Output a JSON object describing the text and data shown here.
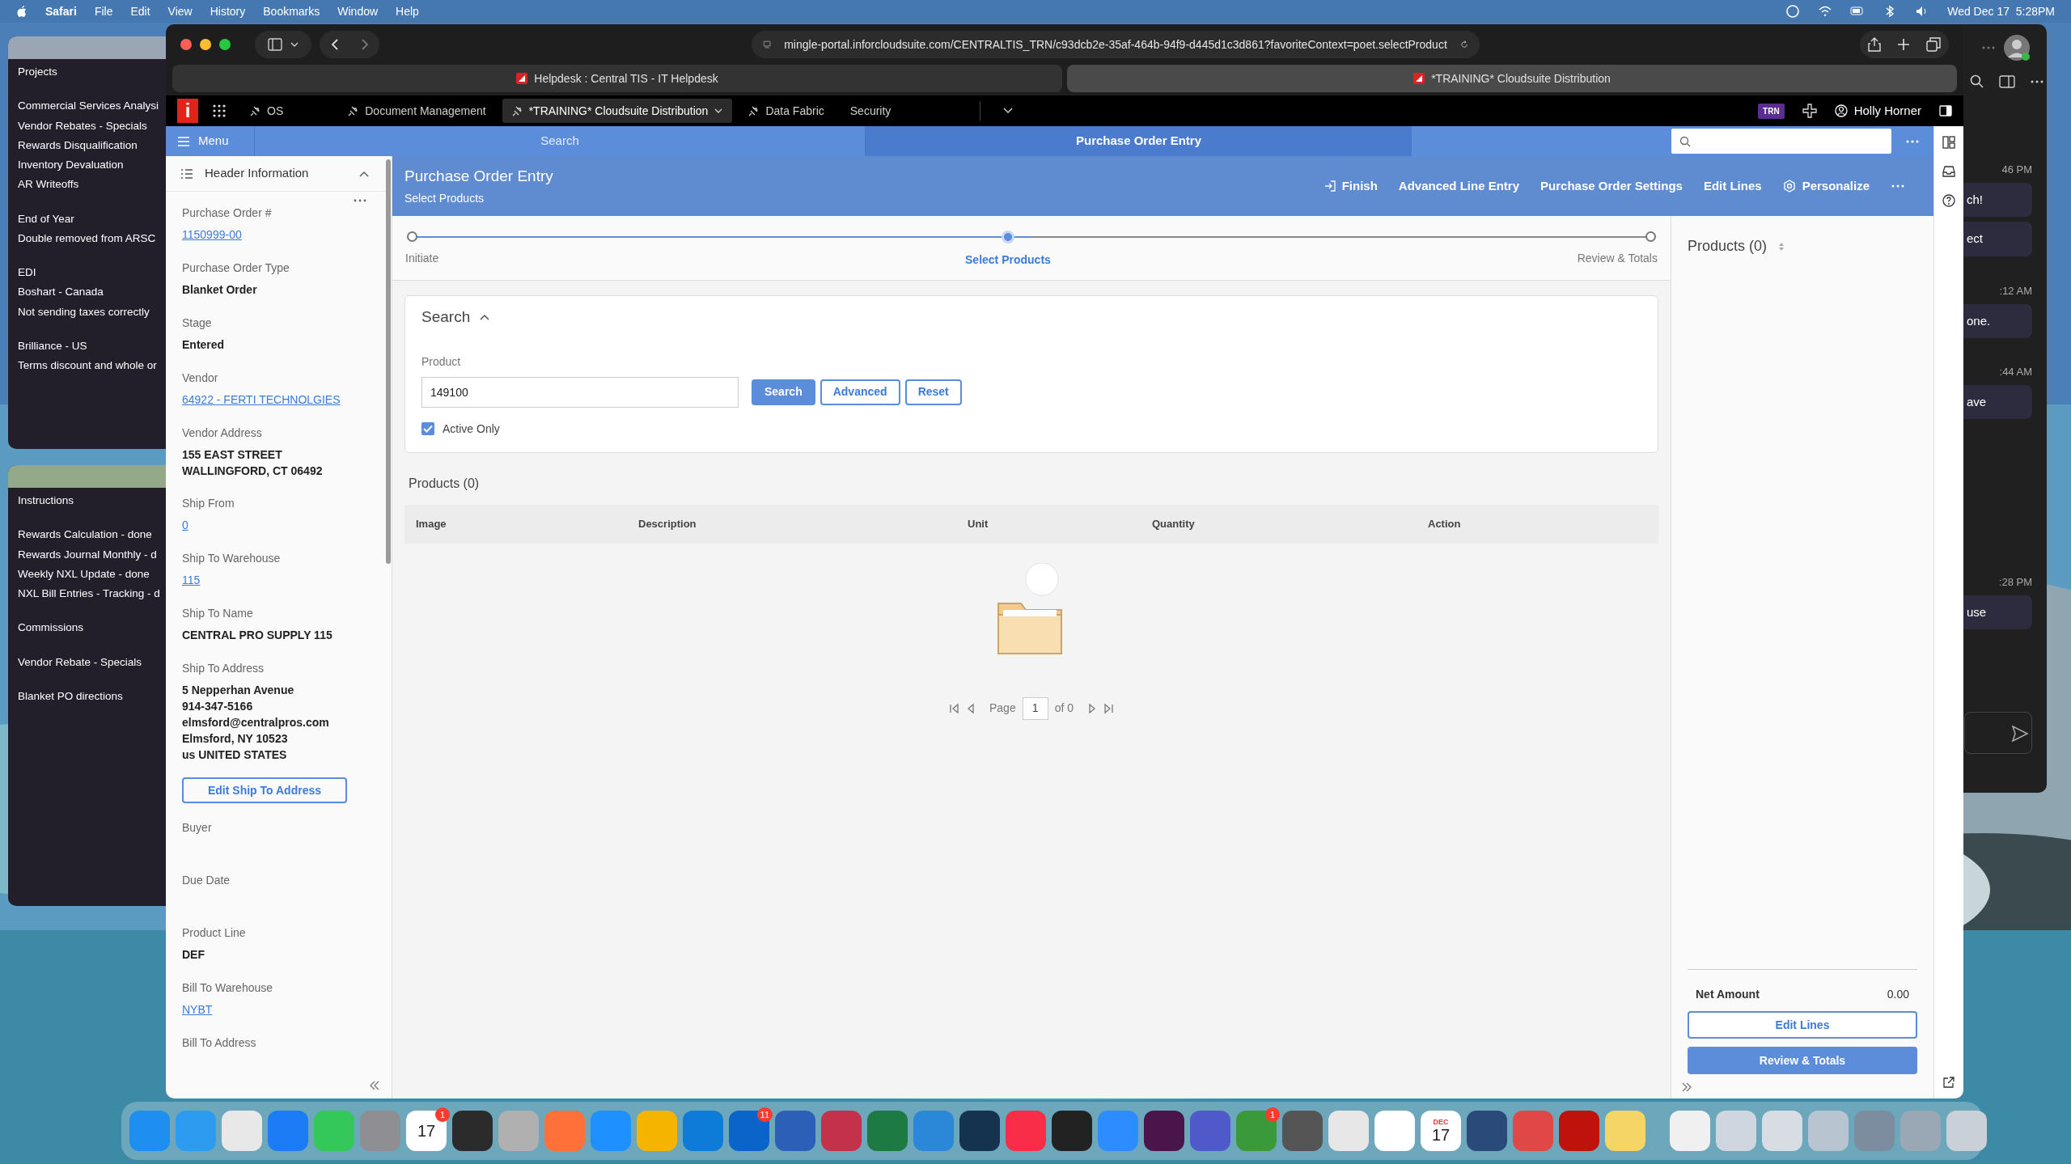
{
  "menu_bar": {
    "app": "Safari",
    "items": [
      "File",
      "Edit",
      "View",
      "History",
      "Bookmarks",
      "Window",
      "Help"
    ],
    "clock": "Wed Dec 17  5:28PM"
  },
  "notes_windows": [
    {
      "groups": [
        [
          "Projects"
        ],
        [
          "Commercial Services Analysi",
          "Vendor Rebates - Specials",
          "Rewards Disqualification",
          "Inventory Devaluation",
          "AR Writeoffs"
        ],
        [
          "End of Year",
          "Double removed from ARSC"
        ],
        [
          "EDI",
          "Boshart - Canada",
          "Not sending taxes correctly"
        ],
        [
          "Brilliance - US",
          "Terms discount and whole or"
        ]
      ]
    },
    {
      "groups": [
        [
          "Instructions"
        ],
        [
          "Rewards Calculation - done",
          "Rewards Journal Monthly - d",
          "Weekly NXL Update - done",
          "NXL Bill Entries - Tracking - d"
        ],
        [
          "Commissions"
        ],
        [
          "Vendor Rebate - Specials"
        ],
        [
          "Blanket PO directions"
        ]
      ]
    }
  ],
  "browser": {
    "url": "mingle-portal.inforcloudsuite.com/CENTRALTIS_TRN/c93dcb2e-35af-464b-94f9-d445d1c3d861?favoriteContext=poet.selectProduct",
    "tabs": [
      {
        "title": "Helpdesk : Central TIS - IT Helpdesk",
        "selected": false
      },
      {
        "title": "*TRAINING* Cloudsuite Distribution",
        "selected": true
      }
    ]
  },
  "portal": {
    "logo": "i",
    "nav": [
      {
        "label": "OS",
        "selected": false
      },
      {
        "label": "Document Management",
        "selected": false
      },
      {
        "label": "*TRAINING* Cloudsuite Distribution",
        "selected": true
      },
      {
        "label": "Data Fabric",
        "selected": false
      },
      {
        "label": "Security",
        "selected": false
      }
    ],
    "env_badge": "TRN",
    "user": "Holly Horner"
  },
  "app_bar": {
    "menu": "Menu",
    "search": "Search",
    "title": "Purchase Order Entry"
  },
  "header_panel": {
    "title": "Header Information",
    "fields": [
      {
        "label": "Purchase Order #",
        "kind": "link",
        "value": "1150999-00"
      },
      {
        "label": "Purchase Order Type",
        "kind": "text",
        "value": "Blanket Order"
      },
      {
        "label": "Stage",
        "kind": "text",
        "value": "Entered"
      },
      {
        "label": "Vendor",
        "kind": "link",
        "value": "64922 - FERTI TECHNOLGIES"
      },
      {
        "label": "Vendor Address",
        "kind": "text",
        "lines": [
          "155 EAST STREET",
          "WALLINGFORD, CT 06492"
        ]
      },
      {
        "label": "Ship From",
        "kind": "link",
        "value": "0"
      },
      {
        "label": "Ship To Warehouse",
        "kind": "link",
        "value": "115"
      },
      {
        "label": "Ship To Name",
        "kind": "text",
        "value": "CENTRAL PRO SUPPLY 115"
      },
      {
        "label": "Ship To Address",
        "kind": "text",
        "lines": [
          "5 Nepperhan Avenue",
          "914-347-5166",
          "elmsford@centralpros.com",
          "Elmsford, NY 10523",
          "us UNITED STATES"
        ],
        "button": "Edit Ship To Address"
      },
      {
        "label": "Buyer",
        "kind": "empty"
      },
      {
        "label": "Due Date",
        "kind": "empty"
      },
      {
        "label": "Product Line",
        "kind": "text",
        "value": "DEF"
      },
      {
        "label": "Bill To Warehouse",
        "kind": "link",
        "value": "NYBT"
      },
      {
        "label": "Bill To Address",
        "kind": "empty"
      }
    ]
  },
  "page": {
    "title": "Purchase Order Entry",
    "subtitle": "Select Products",
    "actions": [
      "Finish",
      "Advanced Line Entry",
      "Purchase Order Settings",
      "Edit Lines",
      "Personalize"
    ]
  },
  "steps": [
    {
      "label": "Initiate",
      "selected": false
    },
    {
      "label": "Select Products",
      "selected": true
    },
    {
      "label": "Review & Totals",
      "selected": false
    }
  ],
  "search": {
    "title": "Search",
    "expanded": true,
    "field_label": "Product",
    "value": "149100",
    "buttons": [
      "Search",
      "Advanced",
      "Reset"
    ],
    "active_only": {
      "label": "Active Only",
      "checked": true
    }
  },
  "products": {
    "title": "Products (0)",
    "columns": [
      "Image",
      "Description",
      "Unit",
      "Quantity",
      "Action"
    ],
    "pager": {
      "label": "Page",
      "page": "1",
      "of": "of 0"
    }
  },
  "summary": {
    "title": "Products (0)",
    "net_label": "Net Amount",
    "net_value": "0.00",
    "buttons": [
      "Edit Lines",
      "Review & Totals"
    ]
  },
  "chat": [
    {
      "time": "46 PM",
      "bubbles": [
        "ch!",
        "ect"
      ]
    },
    {
      "time": ":12 AM",
      "bubbles": [
        "one."
      ]
    },
    {
      "time": ":44 AM",
      "bubbles": [
        "ave"
      ]
    },
    {
      "time": ":28 PM",
      "bubbles": [
        "use"
      ]
    }
  ],
  "dock": [
    {
      "kind": "app"
    },
    {
      "kind": "app"
    },
    {
      "kind": "app"
    },
    {
      "kind": "app"
    },
    {
      "kind": "app"
    },
    {
      "kind": "app"
    },
    {
      "kind": "calendar",
      "text": "17",
      "badge": "1"
    },
    {
      "kind": "app"
    },
    {
      "kind": "app"
    },
    {
      "kind": "app"
    },
    {
      "kind": "app"
    },
    {
      "kind": "app"
    },
    {
      "kind": "app"
    },
    {
      "kind": "app",
      "badge": "11"
    },
    {
      "kind": "app"
    },
    {
      "kind": "app"
    },
    {
      "kind": "app"
    },
    {
      "kind": "app"
    },
    {
      "kind": "app"
    },
    {
      "kind": "app"
    },
    {
      "kind": "app"
    },
    {
      "kind": "app"
    },
    {
      "kind": "app"
    },
    {
      "kind": "app"
    },
    {
      "kind": "app",
      "badge": "1"
    },
    {
      "kind": "app"
    },
    {
      "kind": "app"
    },
    {
      "kind": "app"
    },
    {
      "kind": "calendar",
      "month": "DEC",
      "text": "17"
    },
    {
      "kind": "app"
    },
    {
      "kind": "app"
    },
    {
      "kind": "app"
    },
    {
      "kind": "app"
    },
    {
      "kind": "app"
    },
    {
      "kind": "app"
    },
    {
      "kind": "app"
    },
    {
      "kind": "app"
    },
    {
      "kind": "app"
    },
    {
      "kind": "app"
    },
    {
      "kind": "app"
    }
  ]
}
